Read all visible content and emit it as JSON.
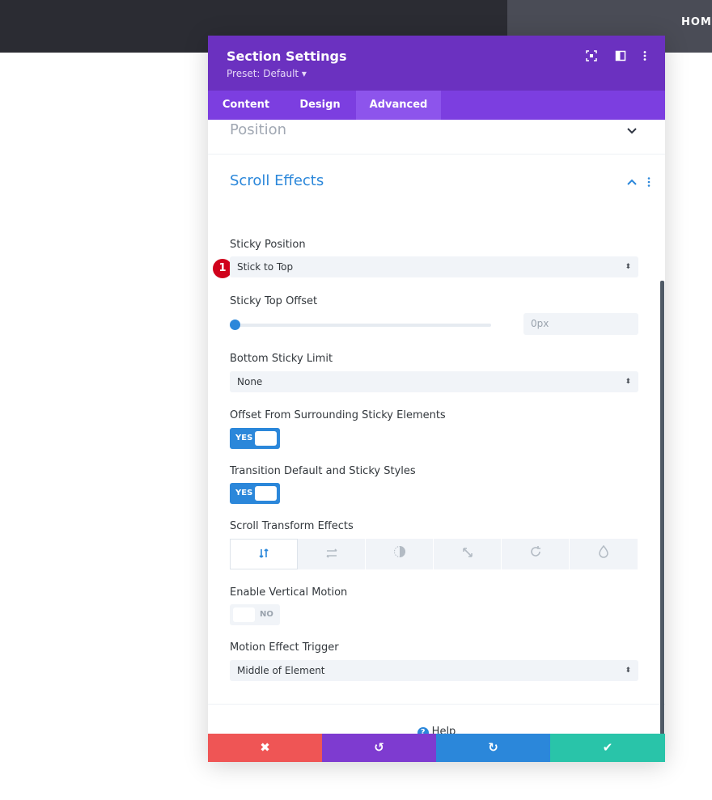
{
  "nav": {
    "home": "HOME"
  },
  "modal": {
    "title": "Section Settings",
    "preset": "Preset: Default ▾",
    "header_icons": [
      "fullscreen-icon",
      "split-view-icon",
      "more-icon"
    ],
    "tabs": [
      {
        "label": "Content",
        "active": false
      },
      {
        "label": "Design",
        "active": false
      },
      {
        "label": "Advanced",
        "active": true
      }
    ]
  },
  "sections": {
    "position": {
      "title": "Position"
    },
    "scroll_effects": {
      "title": "Scroll Effects"
    }
  },
  "fields": {
    "sticky_position": {
      "label": "Sticky Position",
      "value": "Stick to Top",
      "marker": "1"
    },
    "sticky_top_offset": {
      "label": "Sticky Top Offset",
      "placeholder": "0px",
      "slider_fraction": 0
    },
    "bottom_sticky_limit": {
      "label": "Bottom Sticky Limit",
      "value": "None"
    },
    "offset_surrounding": {
      "label": "Offset From Surrounding Sticky Elements",
      "toggle": "YES"
    },
    "transition_styles": {
      "label": "Transition Default and Sticky Styles",
      "toggle": "YES"
    },
    "scroll_transform": {
      "label": "Scroll Transform Effects",
      "options": [
        "vertical-motion-icon",
        "horizontal-motion-icon",
        "fade-icon",
        "scale-icon",
        "rotate-icon",
        "blur-icon"
      ],
      "active_index": 0
    },
    "vertical_motion": {
      "label": "Enable Vertical Motion",
      "toggle": "NO"
    },
    "motion_trigger": {
      "label": "Motion Effect Trigger",
      "value": "Middle of Element"
    }
  },
  "help": {
    "label": "Help"
  },
  "footer": {
    "buttons": [
      {
        "name": "discard",
        "icon": "✖",
        "color": "#ef5555"
      },
      {
        "name": "undo",
        "icon": "↺",
        "color": "#7e3bd0"
      },
      {
        "name": "redo",
        "icon": "↻",
        "color": "#2b87da"
      },
      {
        "name": "save",
        "icon": "✔",
        "color": "#29c4a9"
      }
    ]
  },
  "colors": {
    "accent": "#2b87da",
    "header": "#6b31c0",
    "tabs": "#7c3ee0",
    "section_title": "#2b87da",
    "muted_section_title": "#a1a8b3"
  }
}
